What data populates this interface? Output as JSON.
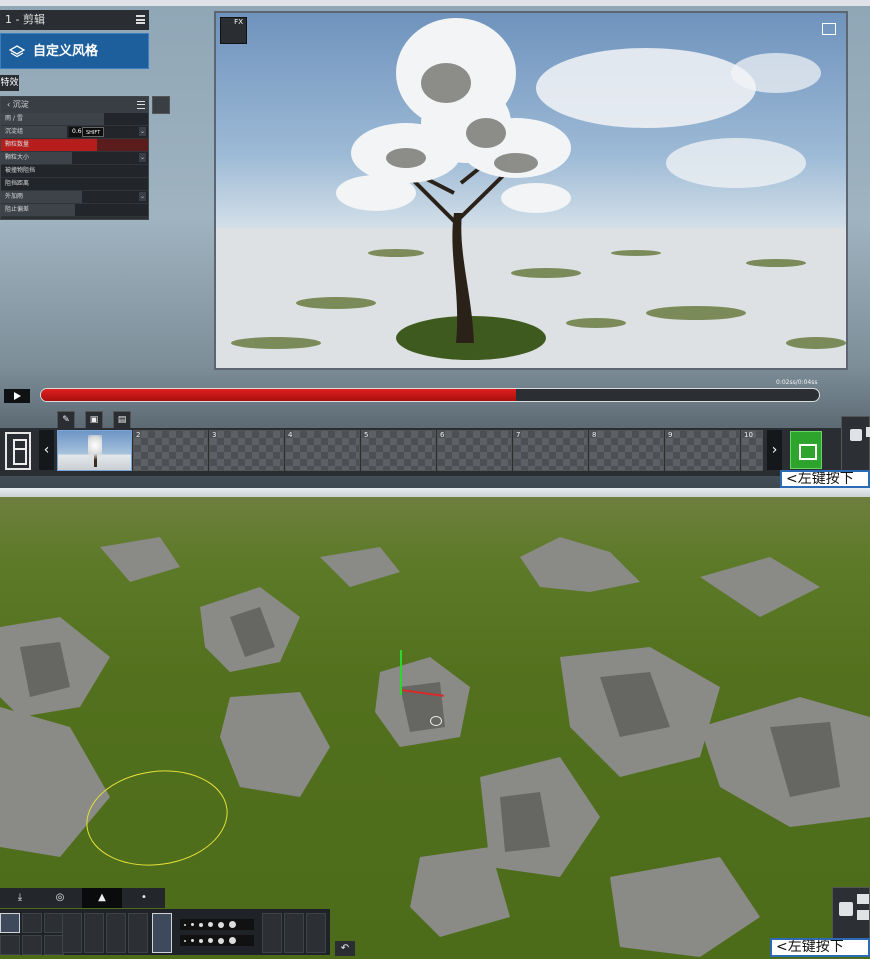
{
  "window": {
    "title": ""
  },
  "left_panel": {
    "clip_title": "1 - 剪辑",
    "style_button": "自定义风格",
    "fx_tab": "特效",
    "effect_name": "沉淀",
    "params": [
      {
        "label": "雨 / 雪",
        "level": 0.7
      },
      {
        "label": "沉淀组",
        "level": 0.45,
        "value": "0.6",
        "modifier": "SHIFT"
      },
      {
        "label": "颗粒数量",
        "level": 0.65
      },
      {
        "label": "颗粒大小",
        "level": 0.48
      },
      {
        "label": "被撞物阻挡",
        "level": 0.0
      },
      {
        "label": "阻挡距离",
        "level": 0.0
      },
      {
        "label": "外加雨",
        "level": 0.55
      },
      {
        "label": "阻止偏差",
        "level": 0.5
      }
    ]
  },
  "viewport": {
    "fx_label": "FX"
  },
  "transport": {
    "progress": 0.61,
    "time": "0:02ss/0:04ss"
  },
  "keyframes": {
    "numbers": [
      "",
      "2",
      "3",
      "4",
      "5",
      "6",
      "7",
      "8",
      "9",
      "10"
    ]
  },
  "hint": {
    "text_top": "<左键按下",
    "text_bottom": "<左键按下"
  },
  "terrain": {
    "brush_dots": [
      2,
      3,
      4,
      5,
      6,
      7
    ]
  },
  "colors": {
    "accent_blue": "#1c5f9c",
    "progress_red": "#d01818",
    "add_green": "#2fa42d",
    "selection_yellow": "#e6e23a"
  },
  "icons": [
    "layer-icon",
    "hamburger-icon",
    "trash-icon",
    "fx-icon",
    "maximize-icon",
    "play-icon",
    "pencil-icon",
    "film-add-icon",
    "list-icon",
    "chevron-left-icon",
    "chevron-right-icon",
    "film-icon",
    "camera-icon",
    "undo-icon"
  ]
}
